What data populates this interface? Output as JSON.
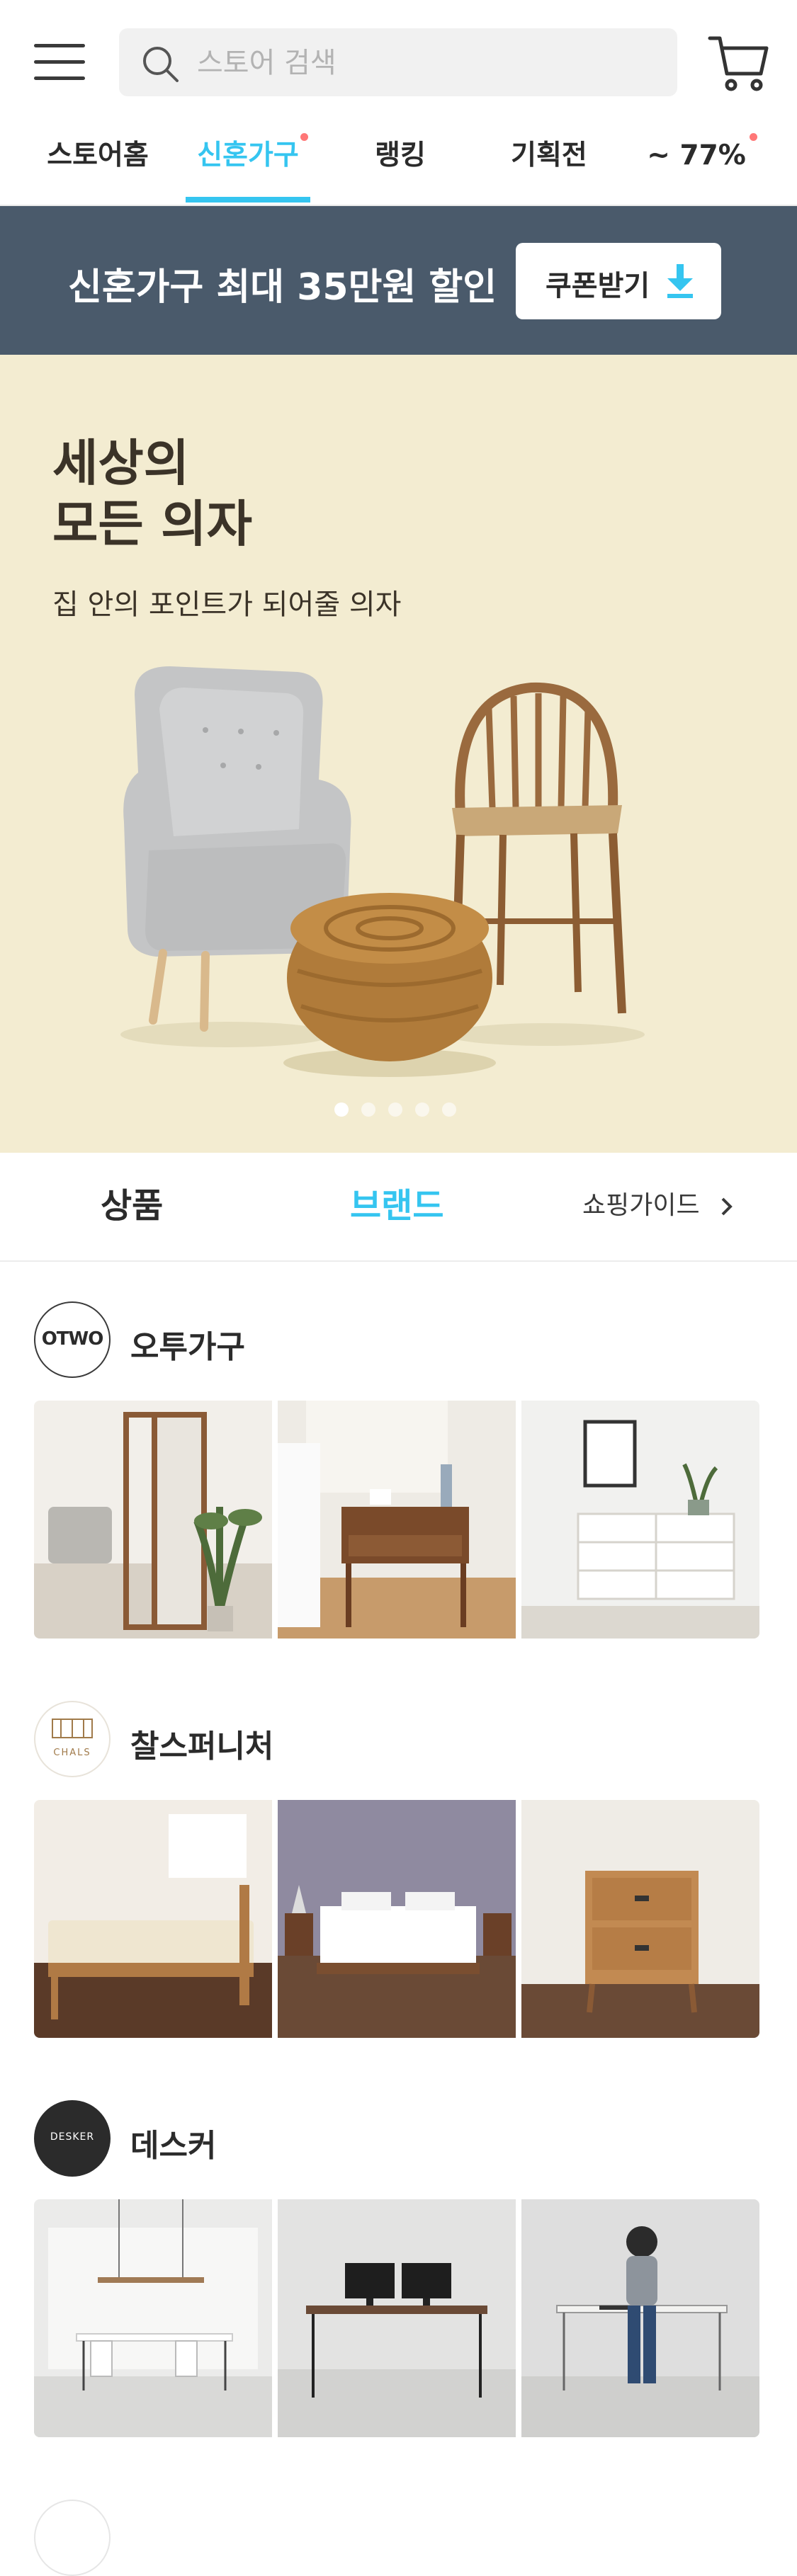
{
  "header": {
    "search_placeholder": "스토어 검색"
  },
  "nav_tabs": [
    {
      "label": "스토어홈",
      "active": false,
      "badge": false
    },
    {
      "label": "신혼가구",
      "active": true,
      "badge": true
    },
    {
      "label": "랭킹",
      "active": false,
      "badge": false
    },
    {
      "label": "기획전",
      "active": false,
      "badge": false
    },
    {
      "label": "~ 77%",
      "active": false,
      "badge": true
    }
  ],
  "coupon": {
    "text": "신혼가구 최대 35만원 할인",
    "button_label": "쿠폰받기"
  },
  "banner": {
    "title_line1": "세상의",
    "title_line2": "모든 의자",
    "subtitle": "집 안의 포인트가 되어줄 의자",
    "slide_count": 5,
    "active_slide": 1
  },
  "section_tabs": {
    "products": "상품",
    "brands": "브랜드",
    "guide": "쇼핑가이드"
  },
  "brands": [
    {
      "name": "오투가구",
      "logo_text": "OTWO"
    },
    {
      "name": "찰스퍼니처",
      "logo_text": "CHALS"
    },
    {
      "name": "데스커",
      "logo_text": "DESKER"
    }
  ],
  "colors": {
    "accent": "#35c5f0",
    "coupon_bg": "#4a5a6b",
    "banner_bg": "#f3ecd1",
    "badge": "#ff7777"
  }
}
